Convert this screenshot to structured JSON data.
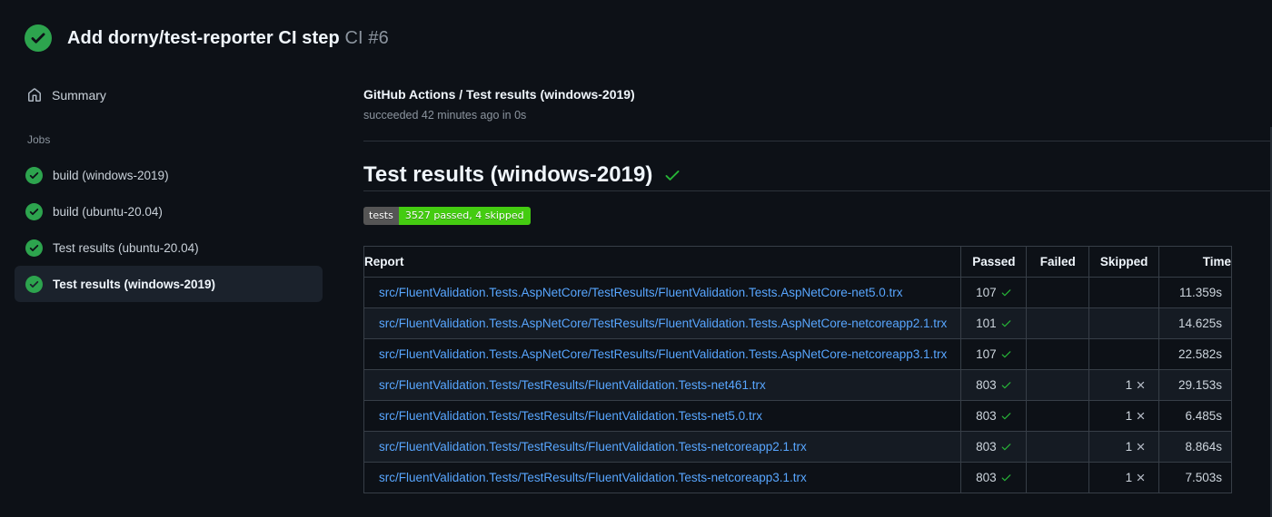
{
  "colors": {
    "page_bg": "#0d1117",
    "divider": "#2c323a",
    "table_border": "#373e47",
    "link_blue": "#58a6ff",
    "success_green": "#2da44e",
    "check_green": "#27b437",
    "x_gray": "#b7bdc8",
    "badge_label_bg": "#555555",
    "badge_value_bg": "#44cc11"
  },
  "header": {
    "title": "Add dorny/test-reporter CI step",
    "run_label": "CI #6"
  },
  "sidebar": {
    "summary_label": "Summary",
    "jobs_heading": "Jobs",
    "jobs": [
      {
        "label": "build (windows-2019)",
        "selected": false
      },
      {
        "label": "build (ubuntu-20.04)",
        "selected": false
      },
      {
        "label": "Test results (ubuntu-20.04)",
        "selected": false
      },
      {
        "label": "Test results (windows-2019)",
        "selected": true
      }
    ]
  },
  "main": {
    "job_title": "GitHub Actions / Test results (windows-2019)",
    "job_status": "succeeded 42 minutes ago in 0s",
    "section_heading": "Test results (windows-2019)",
    "badge": {
      "label": "tests",
      "value": "3527 passed, 4 skipped"
    },
    "table": {
      "headers": [
        "Report",
        "Passed",
        "Failed",
        "Skipped",
        "Time"
      ],
      "rows": [
        {
          "report": "src/FluentValidation.Tests.AspNetCore/TestResults/FluentValidation.Tests.AspNetCore-net5.0.trx",
          "passed": "107",
          "failed": "",
          "skipped": "",
          "time": "11.359s"
        },
        {
          "report": "src/FluentValidation.Tests.AspNetCore/TestResults/FluentValidation.Tests.AspNetCore-netcoreapp2.1.trx",
          "passed": "101",
          "failed": "",
          "skipped": "",
          "time": "14.625s"
        },
        {
          "report": "src/FluentValidation.Tests.AspNetCore/TestResults/FluentValidation.Tests.AspNetCore-netcoreapp3.1.trx",
          "passed": "107",
          "failed": "",
          "skipped": "",
          "time": "22.582s"
        },
        {
          "report": "src/FluentValidation.Tests/TestResults/FluentValidation.Tests-net461.trx",
          "passed": "803",
          "failed": "",
          "skipped": "1",
          "time": "29.153s"
        },
        {
          "report": "src/FluentValidation.Tests/TestResults/FluentValidation.Tests-net5.0.trx",
          "passed": "803",
          "failed": "",
          "skipped": "1",
          "time": "6.485s"
        },
        {
          "report": "src/FluentValidation.Tests/TestResults/FluentValidation.Tests-netcoreapp2.1.trx",
          "passed": "803",
          "failed": "",
          "skipped": "1",
          "time": "8.864s"
        },
        {
          "report": "src/FluentValidation.Tests/TestResults/FluentValidation.Tests-netcoreapp3.1.trx",
          "passed": "803",
          "failed": "",
          "skipped": "1",
          "time": "7.503s"
        }
      ]
    }
  }
}
